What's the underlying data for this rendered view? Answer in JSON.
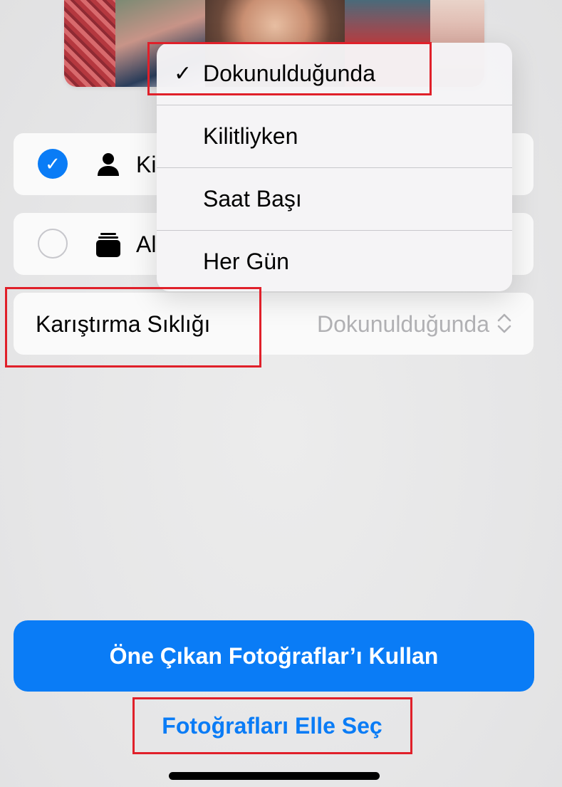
{
  "options": [
    {
      "label": "Ki",
      "selected": true,
      "icon": "person-icon"
    },
    {
      "label": "Al",
      "selected": false,
      "icon": "album-stack-icon"
    }
  ],
  "shuffle": {
    "label": "Karıştırma Sıklığı",
    "value": "Dokunulduğunda"
  },
  "menu": {
    "check_glyph": "✓",
    "items": [
      {
        "label": "Dokunulduğunda",
        "checked": true
      },
      {
        "label": "Kilitliyken",
        "checked": false
      },
      {
        "label": "Saat Başı",
        "checked": false
      },
      {
        "label": "Her Gün",
        "checked": false
      }
    ]
  },
  "buttons": {
    "primary": "Öne Çıkan Fotoğraflar’ı Kullan",
    "secondary": "Fotoğrafları Elle Seç"
  },
  "colors": {
    "accent": "#0a7cf6",
    "highlight": "#e0202a"
  }
}
